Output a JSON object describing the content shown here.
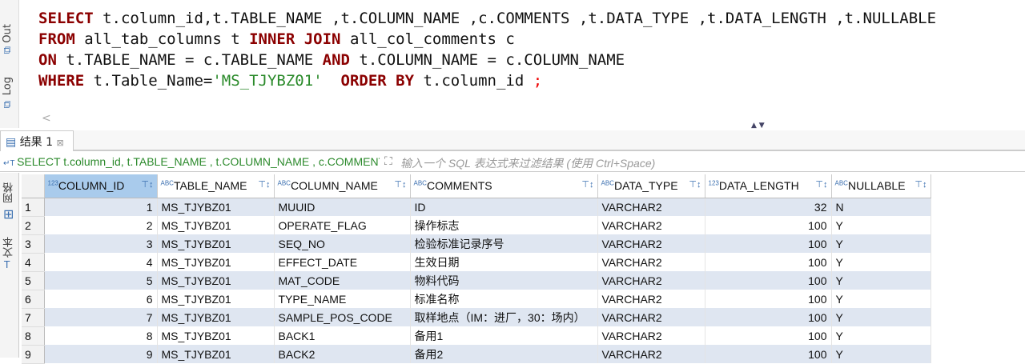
{
  "side_tabs": {
    "out": "Out",
    "log": "Log",
    "grid": "网格",
    "text": "文本"
  },
  "sql": {
    "line1": "SELECT t.column_id,t.TABLE_NAME ,t.COLUMN_NAME ,c.COMMENTS ,t.DATA_TYPE ,t.DATA_LENGTH ,t.NULLABLE",
    "line2_kw1": "FROM",
    "line2": " all_tab_columns t ",
    "line2_kw2": "INNER JOIN",
    "line2b": " all_col_comments c",
    "line3_kw1": "ON",
    "line3a": " t.TABLE_NAME = c.TABLE_NAME ",
    "line3_kw2": "AND",
    "line3b": " t.COLUMN_NAME = c.COLUMN_NAME",
    "line4_kw1": "WHERE",
    "line4a": " t.Table_Name=",
    "line4_str": "'MS_TJYBZ01'",
    "line4_kw2": "  ORDER BY",
    "line4b": " t.column_id ",
    "line4_semi": ";"
  },
  "results_tab": {
    "label": "结果 1",
    "close": "⊠"
  },
  "filter": {
    "query": "SELECT t.column_id, t.TABLE_NAME , t.COLUMN_NAME , c.COMMENTS , t.DATA_TYPE , t.DATA_LENGTH , t.NULLABLE FROM all_tab_columns",
    "placeholder": "输入一个 SQL 表达式来过滤结果 (使用 Ctrl+Space)"
  },
  "columns": [
    {
      "name": "COLUMN_ID",
      "type": "123"
    },
    {
      "name": "TABLE_NAME",
      "type": "ABC"
    },
    {
      "name": "COLUMN_NAME",
      "type": "ABC"
    },
    {
      "name": "COMMENTS",
      "type": "ABC"
    },
    {
      "name": "DATA_TYPE",
      "type": "ABC"
    },
    {
      "name": "DATA_LENGTH",
      "type": "123"
    },
    {
      "name": "NULLABLE",
      "type": "ABC"
    }
  ],
  "rows": [
    [
      "1",
      "1",
      "MS_TJYBZ01",
      "MUUID",
      "ID",
      "VARCHAR2",
      "32",
      "N"
    ],
    [
      "2",
      "2",
      "MS_TJYBZ01",
      "OPERATE_FLAG",
      "操作标志",
      "VARCHAR2",
      "100",
      "Y"
    ],
    [
      "3",
      "3",
      "MS_TJYBZ01",
      "SEQ_NO",
      "检验标准记录序号",
      "VARCHAR2",
      "100",
      "Y"
    ],
    [
      "4",
      "4",
      "MS_TJYBZ01",
      "EFFECT_DATE",
      "生效日期",
      "VARCHAR2",
      "100",
      "Y"
    ],
    [
      "5",
      "5",
      "MS_TJYBZ01",
      "MAT_CODE",
      "物料代码",
      "VARCHAR2",
      "100",
      "Y"
    ],
    [
      "6",
      "6",
      "MS_TJYBZ01",
      "TYPE_NAME",
      "标准名称",
      "VARCHAR2",
      "100",
      "Y"
    ],
    [
      "7",
      "7",
      "MS_TJYBZ01",
      "SAMPLE_POS_CODE",
      "取样地点（IM：进厂，30：场内）",
      "VARCHAR2",
      "100",
      "Y"
    ],
    [
      "8",
      "8",
      "MS_TJYBZ01",
      "BACK1",
      "备用1",
      "VARCHAR2",
      "100",
      "Y"
    ],
    [
      "9",
      "9",
      "MS_TJYBZ01",
      "BACK2",
      "备用2",
      "VARCHAR2",
      "100",
      "Y"
    ]
  ]
}
